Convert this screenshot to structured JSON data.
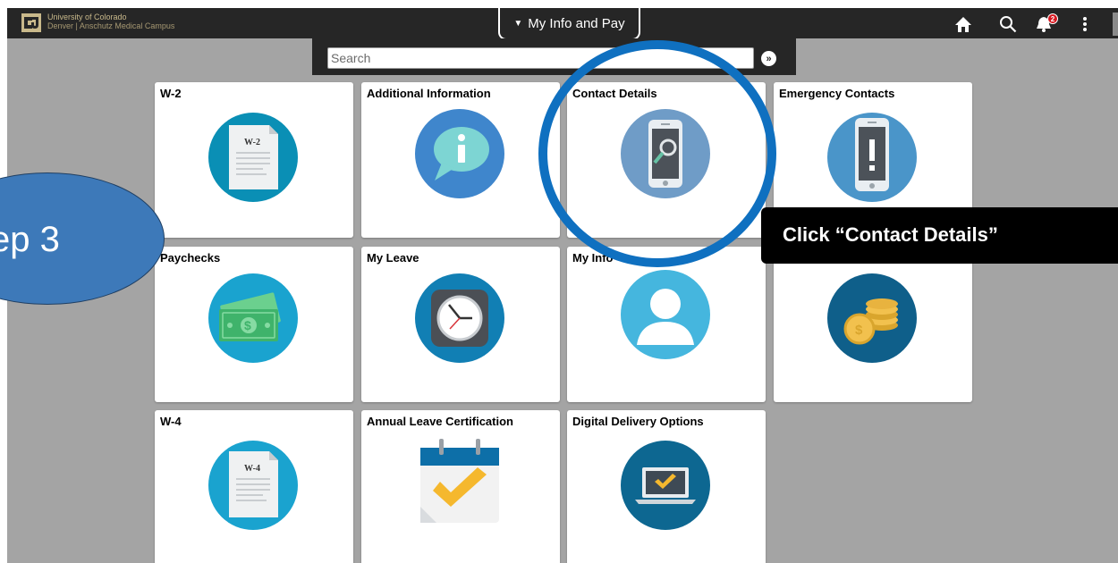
{
  "topbar": {
    "university_name": "University of Colorado",
    "campus_name": "Denver | Anschutz Medical Campus",
    "page_title": "My Info and Pay",
    "notification_count": "2",
    "icons": [
      "home-icon",
      "search-icon",
      "notifications-icon",
      "actions-menu-icon"
    ]
  },
  "search": {
    "placeholder": "Search",
    "go_icon": "double-chevron-right-icon"
  },
  "tiles": [
    {
      "label": "W-2",
      "icon": "w2-document-icon"
    },
    {
      "label": "Additional Information",
      "icon": "info-speech-bubble-icon"
    },
    {
      "label": "Contact Details",
      "icon": "phone-magnifier-icon"
    },
    {
      "label": "Emergency Contacts",
      "icon": "phone-exclamation-icon"
    },
    {
      "label": "Paychecks",
      "icon": "money-bills-icon"
    },
    {
      "label": "My Leave",
      "icon": "clock-icon"
    },
    {
      "label": "My Info",
      "icon": "person-icon"
    },
    {
      "label": "",
      "icon": "coins-icon"
    },
    {
      "label": "W-4",
      "icon": "w4-document-icon"
    },
    {
      "label": "Annual Leave Certification",
      "icon": "calendar-check-icon"
    },
    {
      "label": "Digital Delivery Options",
      "icon": "laptop-check-icon"
    }
  ],
  "document_icon_text": {
    "w2": "W-2",
    "w4": "W-4"
  },
  "annotations": {
    "step_label": "ep 3",
    "instruction": "Click “Contact Details”",
    "highlight_color": "#0f70c0"
  },
  "colors": {
    "topbar_bg": "#262626",
    "page_bg": "#a4a4a4",
    "tile_bg": "#ffffff",
    "brand_gold": "#c9b98b",
    "badge_red": "#d7171f",
    "step_oval": "#3d79b9"
  }
}
